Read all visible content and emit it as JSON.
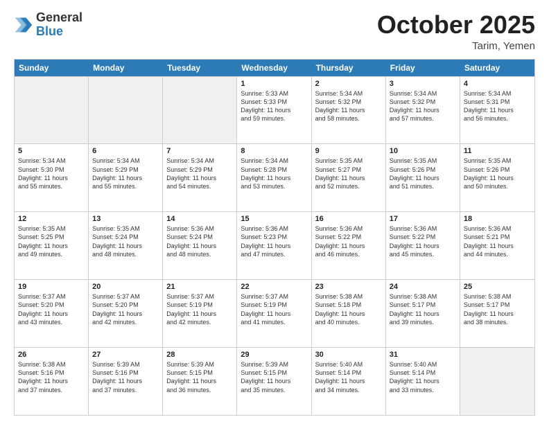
{
  "header": {
    "logo_general": "General",
    "logo_blue": "Blue",
    "month_title": "October 2025",
    "location": "Tarim, Yemen"
  },
  "days_of_week": [
    "Sunday",
    "Monday",
    "Tuesday",
    "Wednesday",
    "Thursday",
    "Friday",
    "Saturday"
  ],
  "rows": [
    [
      {
        "day": "",
        "info": "",
        "shaded": true
      },
      {
        "day": "",
        "info": "",
        "shaded": true
      },
      {
        "day": "",
        "info": "",
        "shaded": true
      },
      {
        "day": "1",
        "info": "Sunrise: 5:33 AM\nSunset: 5:33 PM\nDaylight: 11 hours\nand 59 minutes."
      },
      {
        "day": "2",
        "info": "Sunrise: 5:34 AM\nSunset: 5:32 PM\nDaylight: 11 hours\nand 58 minutes."
      },
      {
        "day": "3",
        "info": "Sunrise: 5:34 AM\nSunset: 5:32 PM\nDaylight: 11 hours\nand 57 minutes."
      },
      {
        "day": "4",
        "info": "Sunrise: 5:34 AM\nSunset: 5:31 PM\nDaylight: 11 hours\nand 56 minutes."
      }
    ],
    [
      {
        "day": "5",
        "info": "Sunrise: 5:34 AM\nSunset: 5:30 PM\nDaylight: 11 hours\nand 55 minutes."
      },
      {
        "day": "6",
        "info": "Sunrise: 5:34 AM\nSunset: 5:29 PM\nDaylight: 11 hours\nand 55 minutes."
      },
      {
        "day": "7",
        "info": "Sunrise: 5:34 AM\nSunset: 5:29 PM\nDaylight: 11 hours\nand 54 minutes."
      },
      {
        "day": "8",
        "info": "Sunrise: 5:34 AM\nSunset: 5:28 PM\nDaylight: 11 hours\nand 53 minutes."
      },
      {
        "day": "9",
        "info": "Sunrise: 5:35 AM\nSunset: 5:27 PM\nDaylight: 11 hours\nand 52 minutes."
      },
      {
        "day": "10",
        "info": "Sunrise: 5:35 AM\nSunset: 5:26 PM\nDaylight: 11 hours\nand 51 minutes."
      },
      {
        "day": "11",
        "info": "Sunrise: 5:35 AM\nSunset: 5:26 PM\nDaylight: 11 hours\nand 50 minutes."
      }
    ],
    [
      {
        "day": "12",
        "info": "Sunrise: 5:35 AM\nSunset: 5:25 PM\nDaylight: 11 hours\nand 49 minutes."
      },
      {
        "day": "13",
        "info": "Sunrise: 5:35 AM\nSunset: 5:24 PM\nDaylight: 11 hours\nand 48 minutes."
      },
      {
        "day": "14",
        "info": "Sunrise: 5:36 AM\nSunset: 5:24 PM\nDaylight: 11 hours\nand 48 minutes."
      },
      {
        "day": "15",
        "info": "Sunrise: 5:36 AM\nSunset: 5:23 PM\nDaylight: 11 hours\nand 47 minutes."
      },
      {
        "day": "16",
        "info": "Sunrise: 5:36 AM\nSunset: 5:22 PM\nDaylight: 11 hours\nand 46 minutes."
      },
      {
        "day": "17",
        "info": "Sunrise: 5:36 AM\nSunset: 5:22 PM\nDaylight: 11 hours\nand 45 minutes."
      },
      {
        "day": "18",
        "info": "Sunrise: 5:36 AM\nSunset: 5:21 PM\nDaylight: 11 hours\nand 44 minutes."
      }
    ],
    [
      {
        "day": "19",
        "info": "Sunrise: 5:37 AM\nSunset: 5:20 PM\nDaylight: 11 hours\nand 43 minutes."
      },
      {
        "day": "20",
        "info": "Sunrise: 5:37 AM\nSunset: 5:20 PM\nDaylight: 11 hours\nand 42 minutes."
      },
      {
        "day": "21",
        "info": "Sunrise: 5:37 AM\nSunset: 5:19 PM\nDaylight: 11 hours\nand 42 minutes."
      },
      {
        "day": "22",
        "info": "Sunrise: 5:37 AM\nSunset: 5:19 PM\nDaylight: 11 hours\nand 41 minutes."
      },
      {
        "day": "23",
        "info": "Sunrise: 5:38 AM\nSunset: 5:18 PM\nDaylight: 11 hours\nand 40 minutes."
      },
      {
        "day": "24",
        "info": "Sunrise: 5:38 AM\nSunset: 5:17 PM\nDaylight: 11 hours\nand 39 minutes."
      },
      {
        "day": "25",
        "info": "Sunrise: 5:38 AM\nSunset: 5:17 PM\nDaylight: 11 hours\nand 38 minutes."
      }
    ],
    [
      {
        "day": "26",
        "info": "Sunrise: 5:38 AM\nSunset: 5:16 PM\nDaylight: 11 hours\nand 37 minutes."
      },
      {
        "day": "27",
        "info": "Sunrise: 5:39 AM\nSunset: 5:16 PM\nDaylight: 11 hours\nand 37 minutes."
      },
      {
        "day": "28",
        "info": "Sunrise: 5:39 AM\nSunset: 5:15 PM\nDaylight: 11 hours\nand 36 minutes."
      },
      {
        "day": "29",
        "info": "Sunrise: 5:39 AM\nSunset: 5:15 PM\nDaylight: 11 hours\nand 35 minutes."
      },
      {
        "day": "30",
        "info": "Sunrise: 5:40 AM\nSunset: 5:14 PM\nDaylight: 11 hours\nand 34 minutes."
      },
      {
        "day": "31",
        "info": "Sunrise: 5:40 AM\nSunset: 5:14 PM\nDaylight: 11 hours\nand 33 minutes."
      },
      {
        "day": "",
        "info": "",
        "shaded": true
      }
    ]
  ]
}
